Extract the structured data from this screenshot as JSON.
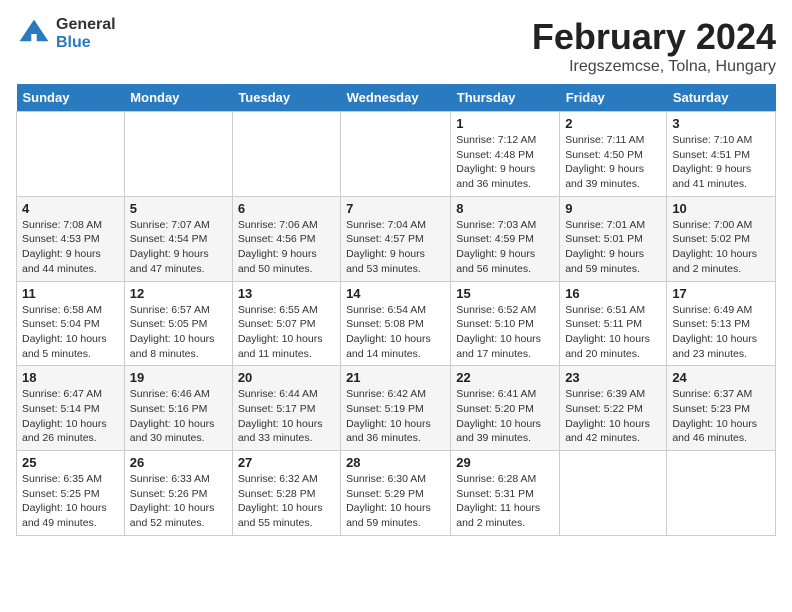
{
  "header": {
    "logo_general": "General",
    "logo_blue": "Blue",
    "month_title": "February 2024",
    "location": "Iregszemcse, Tolna, Hungary"
  },
  "days_of_week": [
    "Sunday",
    "Monday",
    "Tuesday",
    "Wednesday",
    "Thursday",
    "Friday",
    "Saturday"
  ],
  "weeks": [
    [
      {
        "day": "",
        "info": ""
      },
      {
        "day": "",
        "info": ""
      },
      {
        "day": "",
        "info": ""
      },
      {
        "day": "",
        "info": ""
      },
      {
        "day": "1",
        "info": "Sunrise: 7:12 AM\nSunset: 4:48 PM\nDaylight: 9 hours and 36 minutes."
      },
      {
        "day": "2",
        "info": "Sunrise: 7:11 AM\nSunset: 4:50 PM\nDaylight: 9 hours and 39 minutes."
      },
      {
        "day": "3",
        "info": "Sunrise: 7:10 AM\nSunset: 4:51 PM\nDaylight: 9 hours and 41 minutes."
      }
    ],
    [
      {
        "day": "4",
        "info": "Sunrise: 7:08 AM\nSunset: 4:53 PM\nDaylight: 9 hours and 44 minutes."
      },
      {
        "day": "5",
        "info": "Sunrise: 7:07 AM\nSunset: 4:54 PM\nDaylight: 9 hours and 47 minutes."
      },
      {
        "day": "6",
        "info": "Sunrise: 7:06 AM\nSunset: 4:56 PM\nDaylight: 9 hours and 50 minutes."
      },
      {
        "day": "7",
        "info": "Sunrise: 7:04 AM\nSunset: 4:57 PM\nDaylight: 9 hours and 53 minutes."
      },
      {
        "day": "8",
        "info": "Sunrise: 7:03 AM\nSunset: 4:59 PM\nDaylight: 9 hours and 56 minutes."
      },
      {
        "day": "9",
        "info": "Sunrise: 7:01 AM\nSunset: 5:01 PM\nDaylight: 9 hours and 59 minutes."
      },
      {
        "day": "10",
        "info": "Sunrise: 7:00 AM\nSunset: 5:02 PM\nDaylight: 10 hours and 2 minutes."
      }
    ],
    [
      {
        "day": "11",
        "info": "Sunrise: 6:58 AM\nSunset: 5:04 PM\nDaylight: 10 hours and 5 minutes."
      },
      {
        "day": "12",
        "info": "Sunrise: 6:57 AM\nSunset: 5:05 PM\nDaylight: 10 hours and 8 minutes."
      },
      {
        "day": "13",
        "info": "Sunrise: 6:55 AM\nSunset: 5:07 PM\nDaylight: 10 hours and 11 minutes."
      },
      {
        "day": "14",
        "info": "Sunrise: 6:54 AM\nSunset: 5:08 PM\nDaylight: 10 hours and 14 minutes."
      },
      {
        "day": "15",
        "info": "Sunrise: 6:52 AM\nSunset: 5:10 PM\nDaylight: 10 hours and 17 minutes."
      },
      {
        "day": "16",
        "info": "Sunrise: 6:51 AM\nSunset: 5:11 PM\nDaylight: 10 hours and 20 minutes."
      },
      {
        "day": "17",
        "info": "Sunrise: 6:49 AM\nSunset: 5:13 PM\nDaylight: 10 hours and 23 minutes."
      }
    ],
    [
      {
        "day": "18",
        "info": "Sunrise: 6:47 AM\nSunset: 5:14 PM\nDaylight: 10 hours and 26 minutes."
      },
      {
        "day": "19",
        "info": "Sunrise: 6:46 AM\nSunset: 5:16 PM\nDaylight: 10 hours and 30 minutes."
      },
      {
        "day": "20",
        "info": "Sunrise: 6:44 AM\nSunset: 5:17 PM\nDaylight: 10 hours and 33 minutes."
      },
      {
        "day": "21",
        "info": "Sunrise: 6:42 AM\nSunset: 5:19 PM\nDaylight: 10 hours and 36 minutes."
      },
      {
        "day": "22",
        "info": "Sunrise: 6:41 AM\nSunset: 5:20 PM\nDaylight: 10 hours and 39 minutes."
      },
      {
        "day": "23",
        "info": "Sunrise: 6:39 AM\nSunset: 5:22 PM\nDaylight: 10 hours and 42 minutes."
      },
      {
        "day": "24",
        "info": "Sunrise: 6:37 AM\nSunset: 5:23 PM\nDaylight: 10 hours and 46 minutes."
      }
    ],
    [
      {
        "day": "25",
        "info": "Sunrise: 6:35 AM\nSunset: 5:25 PM\nDaylight: 10 hours and 49 minutes."
      },
      {
        "day": "26",
        "info": "Sunrise: 6:33 AM\nSunset: 5:26 PM\nDaylight: 10 hours and 52 minutes."
      },
      {
        "day": "27",
        "info": "Sunrise: 6:32 AM\nSunset: 5:28 PM\nDaylight: 10 hours and 55 minutes."
      },
      {
        "day": "28",
        "info": "Sunrise: 6:30 AM\nSunset: 5:29 PM\nDaylight: 10 hours and 59 minutes."
      },
      {
        "day": "29",
        "info": "Sunrise: 6:28 AM\nSunset: 5:31 PM\nDaylight: 11 hours and 2 minutes."
      },
      {
        "day": "",
        "info": ""
      },
      {
        "day": "",
        "info": ""
      }
    ]
  ]
}
